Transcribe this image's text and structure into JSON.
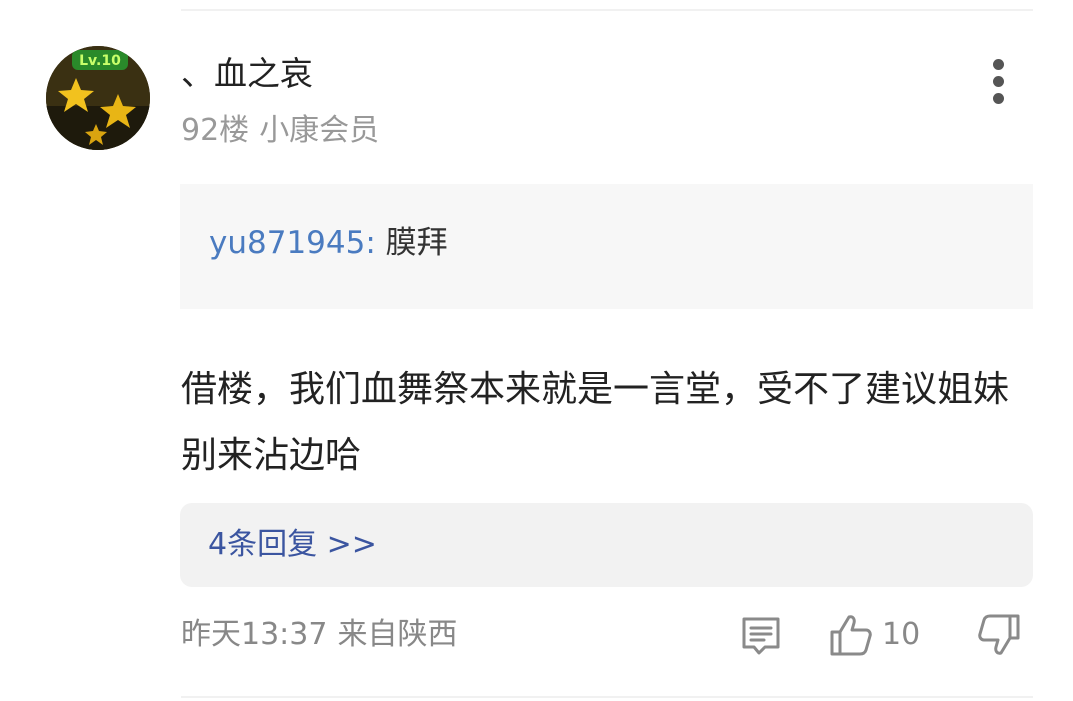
{
  "comment": {
    "username": "、血之哀",
    "floor": "92楼",
    "member_level": "小康会员",
    "avatar_badge_text": "Lv.10",
    "quote": {
      "user": "yu871945:",
      "text": "膜拜"
    },
    "body": "借楼，我们血舞祭本来就是一言堂，受不了建议姐妹别来沾边哈",
    "replies_link": "4条回复 >>",
    "time": "昨天13:37",
    "location": "来自陕西",
    "like_count": "10"
  },
  "colors": {
    "quote_user": "#4a7bc0",
    "reply_link": "#3b55a0",
    "meta_gray": "#999999",
    "quote_bg": "#f7f7f7",
    "reply_bg": "#f2f2f2"
  },
  "icons": [
    "more-vertical-icon",
    "comment-icon",
    "thumbs-up-icon",
    "thumbs-down-icon"
  ]
}
